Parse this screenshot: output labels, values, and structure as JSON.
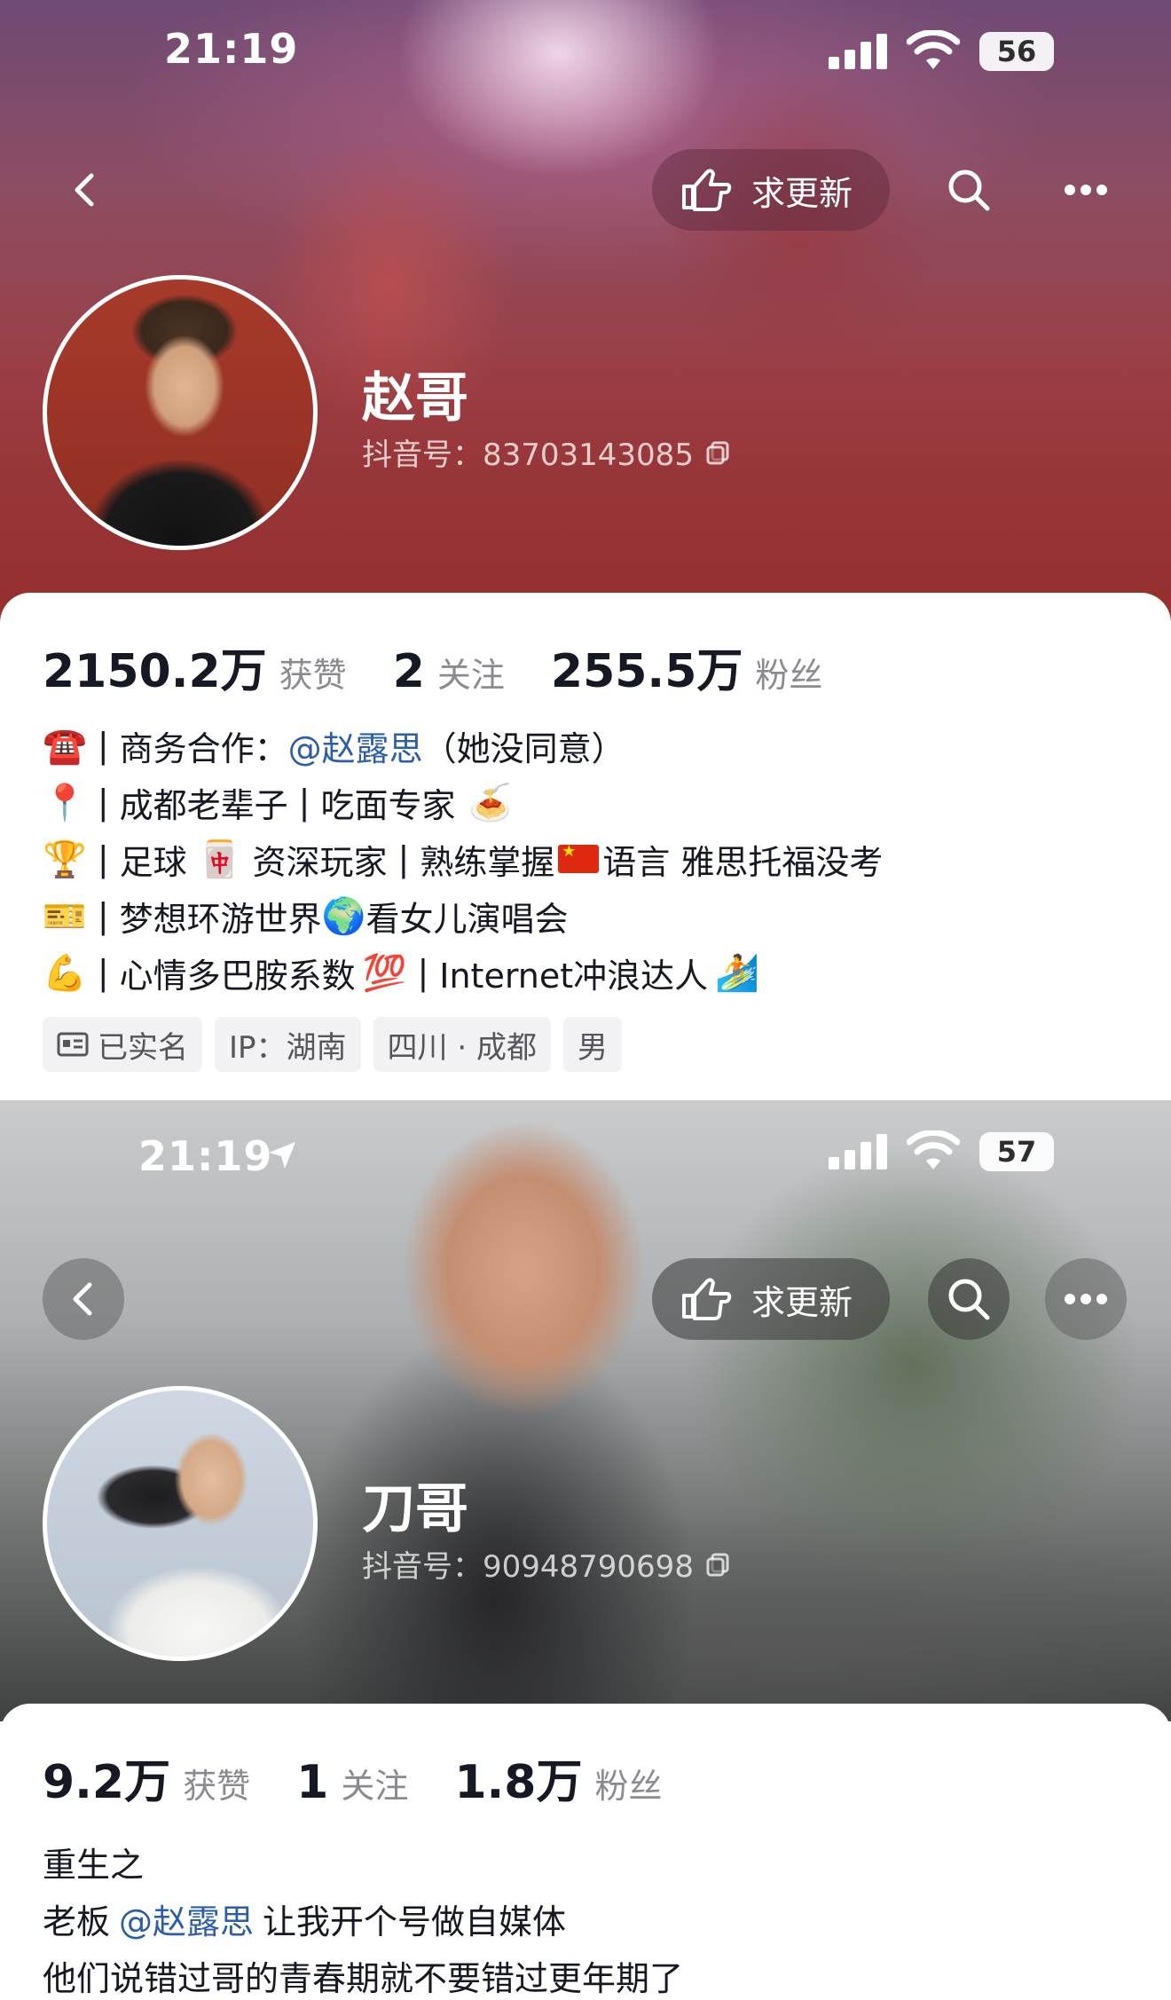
{
  "profiles": [
    {
      "status_bar": {
        "time": "21:19",
        "battery": "56"
      },
      "nav": {
        "update_label": "求更新"
      },
      "name": "赵哥",
      "douyin_id": "抖音号：83703143085",
      "stats": {
        "likes_value": "2150.2万",
        "likes_label": "获赞",
        "following_value": "2",
        "following_label": "关注",
        "followers_value": "255.5万",
        "followers_label": "粉丝"
      },
      "bio": {
        "line1": {
          "emoji": "☎️",
          "sep": "|",
          "text_a": "商务合作：",
          "mention": "@赵露思",
          "text_b": "（她没同意）"
        },
        "line2": {
          "emoji": "📍",
          "sep": "|",
          "text_a": "成都老辈子",
          "sep2": "|",
          "text_b": "吃面专家",
          "emoji2": "🍝"
        },
        "line3": {
          "emoji": "🏆",
          "sep": "|",
          "text_a": "足球",
          "emoji2": "🀄",
          "text_b": "资深玩家",
          "sep2": "|",
          "text_c": "熟练掌握",
          "text_d": "语言 雅思托福没考"
        },
        "line4": {
          "emoji": "🎫",
          "sep": "|",
          "text_a": "梦想环游世界",
          "emoji2": "🌍",
          "text_b": "看女儿演唱会"
        },
        "line5": {
          "emoji": "💪",
          "sep": "|",
          "text_a": "心情多巴胺系数",
          "emoji2": "💯",
          "sep2": "|",
          "text_b": "Internet冲浪达人",
          "emoji3": "🏄"
        }
      },
      "tags": [
        "已实名",
        "IP：湖南",
        "四川 · 成都",
        "男"
      ]
    },
    {
      "status_bar": {
        "time": "21:19",
        "battery": "57"
      },
      "nav": {
        "update_label": "求更新"
      },
      "name": "刀哥",
      "douyin_id": "抖音号：90948790698",
      "stats": {
        "likes_value": "9.2万",
        "likes_label": "获赞",
        "following_value": "1",
        "following_label": "关注",
        "followers_value": "1.8万",
        "followers_label": "粉丝"
      },
      "bio": {
        "line1": "重生之",
        "line2": {
          "text_a": "老板",
          "mention": "@赵露思",
          "text_b": "让我开个号做自媒体"
        },
        "line3": "他们说错过哥的青春期就不要错过更年期了"
      }
    }
  ]
}
